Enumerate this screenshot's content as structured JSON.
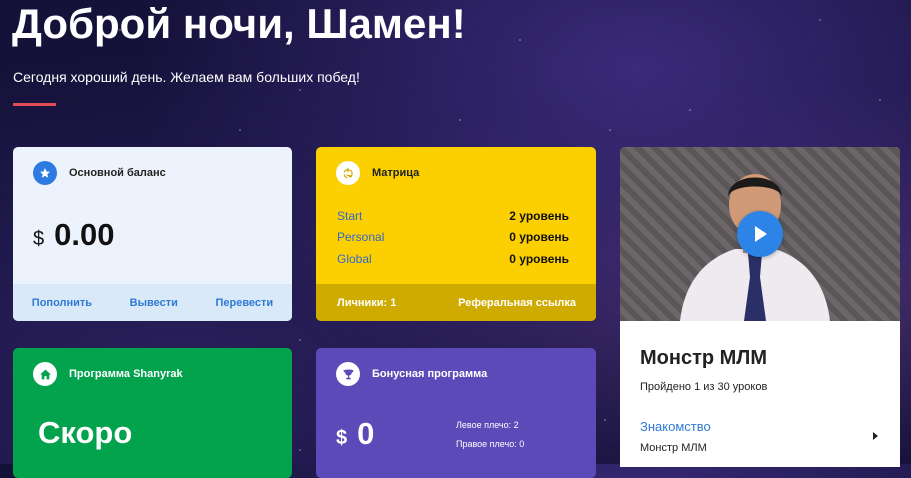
{
  "header": {
    "greeting": "Доброй ночи, Шамен!",
    "subtitle": "Сегодня хороший день. Желаем вам больших побед!",
    "accent_color": "#e14d57"
  },
  "balance": {
    "title": "Основной баланс",
    "icon": "star-icon",
    "currency": "$",
    "amount": "0.00",
    "actions": [
      "Пополнить",
      "Вывести",
      "Перевести"
    ]
  },
  "matrix": {
    "title": "Матрица",
    "icon": "recycle-icon",
    "rows": [
      {
        "name": "Start",
        "level": "2 уровень"
      },
      {
        "name": "Personal",
        "level": "0 уровень"
      },
      {
        "name": "Global",
        "level": "0 уровень"
      }
    ],
    "personal_label": "Личники: 1",
    "referral_label": "Реферальная ссылка",
    "color": "#fcd000"
  },
  "course": {
    "title": "Монстр МЛМ",
    "progress": "Пройдено 1 из 30 уроков",
    "lesson_title": "Знакомство",
    "lesson_subtitle": "Монстр МЛМ",
    "play_icon": "play-icon"
  },
  "shanyrak": {
    "title": "Программа Shanyrak",
    "icon": "home-icon",
    "status": "Скоро",
    "color": "#03a34e"
  },
  "bonus": {
    "title": "Бонусная программа",
    "icon": "trophy-icon",
    "currency": "$",
    "amount": "0",
    "left_shoulder": "Левое плечо: 2",
    "right_shoulder": "Правое плечо: 0",
    "color": "#5b4ab8"
  }
}
